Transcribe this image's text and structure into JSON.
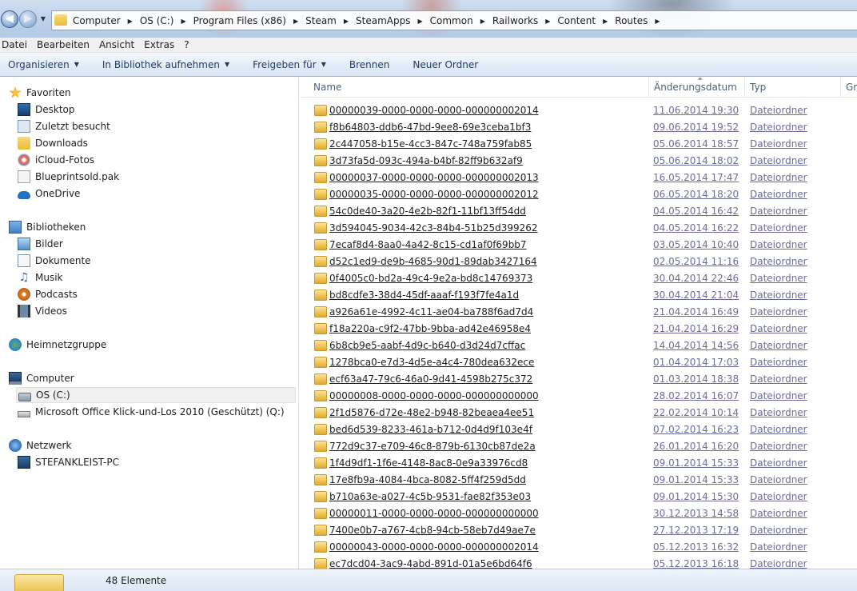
{
  "address_bar": {
    "breadcrumbs": [
      "Computer",
      "OS (C:)",
      "Program Files (x86)",
      "Steam",
      "SteamApps",
      "Common",
      "Railworks",
      "Content",
      "Routes"
    ]
  },
  "menubar": [
    "Datei",
    "Bearbeiten",
    "Ansicht",
    "Extras",
    "?"
  ],
  "commandbar": {
    "organize": "Organisieren",
    "include_library": "In Bibliothek aufnehmen",
    "share": "Freigeben für",
    "burn": "Brennen",
    "new_folder": "Neuer Ordner"
  },
  "navpane": {
    "favorites": {
      "label": "Favoriten",
      "items": [
        "Desktop",
        "Zuletzt besucht",
        "Downloads",
        "iCloud-Fotos",
        "Blueprintsold.pak",
        "OneDrive"
      ]
    },
    "libraries": {
      "label": "Bibliotheken",
      "items": [
        "Bilder",
        "Dokumente",
        "Musik",
        "Podcasts",
        "Videos"
      ]
    },
    "homegroup": {
      "label": "Heimnetzgruppe"
    },
    "computer": {
      "label": "Computer",
      "items": [
        "OS (C:)",
        "Microsoft Office Klick-und-Los 2010 (Geschützt) (Q:)"
      ]
    },
    "network": {
      "label": "Netzwerk",
      "items": [
        "STEFANKLEIST-PC"
      ]
    }
  },
  "columns": {
    "name": "Name",
    "date": "Änderungsdatum",
    "type": "Typ",
    "size": "Grö"
  },
  "files": [
    {
      "name": "00000039-0000-0000-0000-000000002014",
      "date": "11.06.2014 19:30",
      "type": "Dateiordner"
    },
    {
      "name": "f8b64803-ddb6-47bd-9ee8-69e3ceba1bf3",
      "date": "09.06.2014 19:52",
      "type": "Dateiordner"
    },
    {
      "name": "2c447058-b15e-4cc3-847c-748a759fab85",
      "date": "05.06.2014 18:57",
      "type": "Dateiordner"
    },
    {
      "name": "3d73fa5d-093c-494a-b4bf-82ff9b632af9",
      "date": "05.06.2014 18:02",
      "type": "Dateiordner"
    },
    {
      "name": "00000037-0000-0000-0000-000000002013",
      "date": "16.05.2014 17:47",
      "type": "Dateiordner"
    },
    {
      "name": "00000035-0000-0000-0000-000000002012",
      "date": "06.05.2014 18:20",
      "type": "Dateiordner"
    },
    {
      "name": "54c0de40-3a20-4e2b-82f1-11bf13ff54dd",
      "date": "04.05.2014 16:42",
      "type": "Dateiordner"
    },
    {
      "name": "3d594045-9034-42c3-84b4-51b25d399262",
      "date": "04.05.2014 16:22",
      "type": "Dateiordner"
    },
    {
      "name": "7ecaf8d4-8aa0-4a42-8c15-cd1af0f69bb7",
      "date": "03.05.2014 10:40",
      "type": "Dateiordner"
    },
    {
      "name": "d52c1ed9-de9b-4685-90d1-89dab3427164",
      "date": "02.05.2014 11:16",
      "type": "Dateiordner"
    },
    {
      "name": "0f4005c0-bd2a-49c4-9e2a-bd8c14769373",
      "date": "30.04.2014 22:46",
      "type": "Dateiordner"
    },
    {
      "name": "bd8cdfe3-38d4-45df-aaaf-f193f7fe4a1d",
      "date": "30.04.2014 21:04",
      "type": "Dateiordner"
    },
    {
      "name": "a926a61e-4992-4c11-ae04-ba788f6ad7d4",
      "date": "21.04.2014 16:49",
      "type": "Dateiordner"
    },
    {
      "name": "f18a220a-c9f2-47bb-9bba-ad42e46958e4",
      "date": "21.04.2014 16:29",
      "type": "Dateiordner"
    },
    {
      "name": "6b8cb9e5-aabf-4d9c-b640-d3d24d7cffac",
      "date": "14.04.2014 14:56",
      "type": "Dateiordner"
    },
    {
      "name": "1278bca0-e7d3-4d5e-a4c4-780dea632ece",
      "date": "01.04.2014 17:03",
      "type": "Dateiordner"
    },
    {
      "name": "ecf63a47-79c6-46a0-9d41-4598b275c372",
      "date": "01.03.2014 18:38",
      "type": "Dateiordner"
    },
    {
      "name": "00000008-0000-0000-0000-000000000000",
      "date": "28.02.2014 16:07",
      "type": "Dateiordner"
    },
    {
      "name": "2f1d5876-d72e-48e2-b948-82beaea4ee51",
      "date": "22.02.2014 10:14",
      "type": "Dateiordner"
    },
    {
      "name": "bed6d539-8233-461a-b712-0d4d9f103e4f",
      "date": "07.02.2014 16:23",
      "type": "Dateiordner"
    },
    {
      "name": "772d9c37-e709-46c8-879b-6130cb87de2a",
      "date": "26.01.2014 16:20",
      "type": "Dateiordner"
    },
    {
      "name": "1f4d9df1-1f6e-4148-8ac8-0e9a33976cd8",
      "date": "09.01.2014 15:33",
      "type": "Dateiordner"
    },
    {
      "name": "17e8fb9a-4084-4bca-8082-5ff4f259d5dd",
      "date": "09.01.2014 15:33",
      "type": "Dateiordner"
    },
    {
      "name": "b710a63e-a027-4c5b-9531-fae82f353e03",
      "date": "09.01.2014 15:30",
      "type": "Dateiordner"
    },
    {
      "name": "00000011-0000-0000-0000-000000000000",
      "date": "30.12.2013 14:58",
      "type": "Dateiordner"
    },
    {
      "name": "7400e0b7-a767-4cb8-94cb-58eb7d49ae7e",
      "date": "27.12.2013 17:19",
      "type": "Dateiordner"
    },
    {
      "name": "00000043-0000-0000-0000-000000002014",
      "date": "05.12.2013 16:32",
      "type": "Dateiordner"
    },
    {
      "name": "ec7dcd04-3ac9-4abd-891d-01a5e6bd64f6",
      "date": "05.12.2013 16:18",
      "type": "Dateiordner"
    }
  ],
  "statusbar": {
    "count": "48 Elemente"
  }
}
